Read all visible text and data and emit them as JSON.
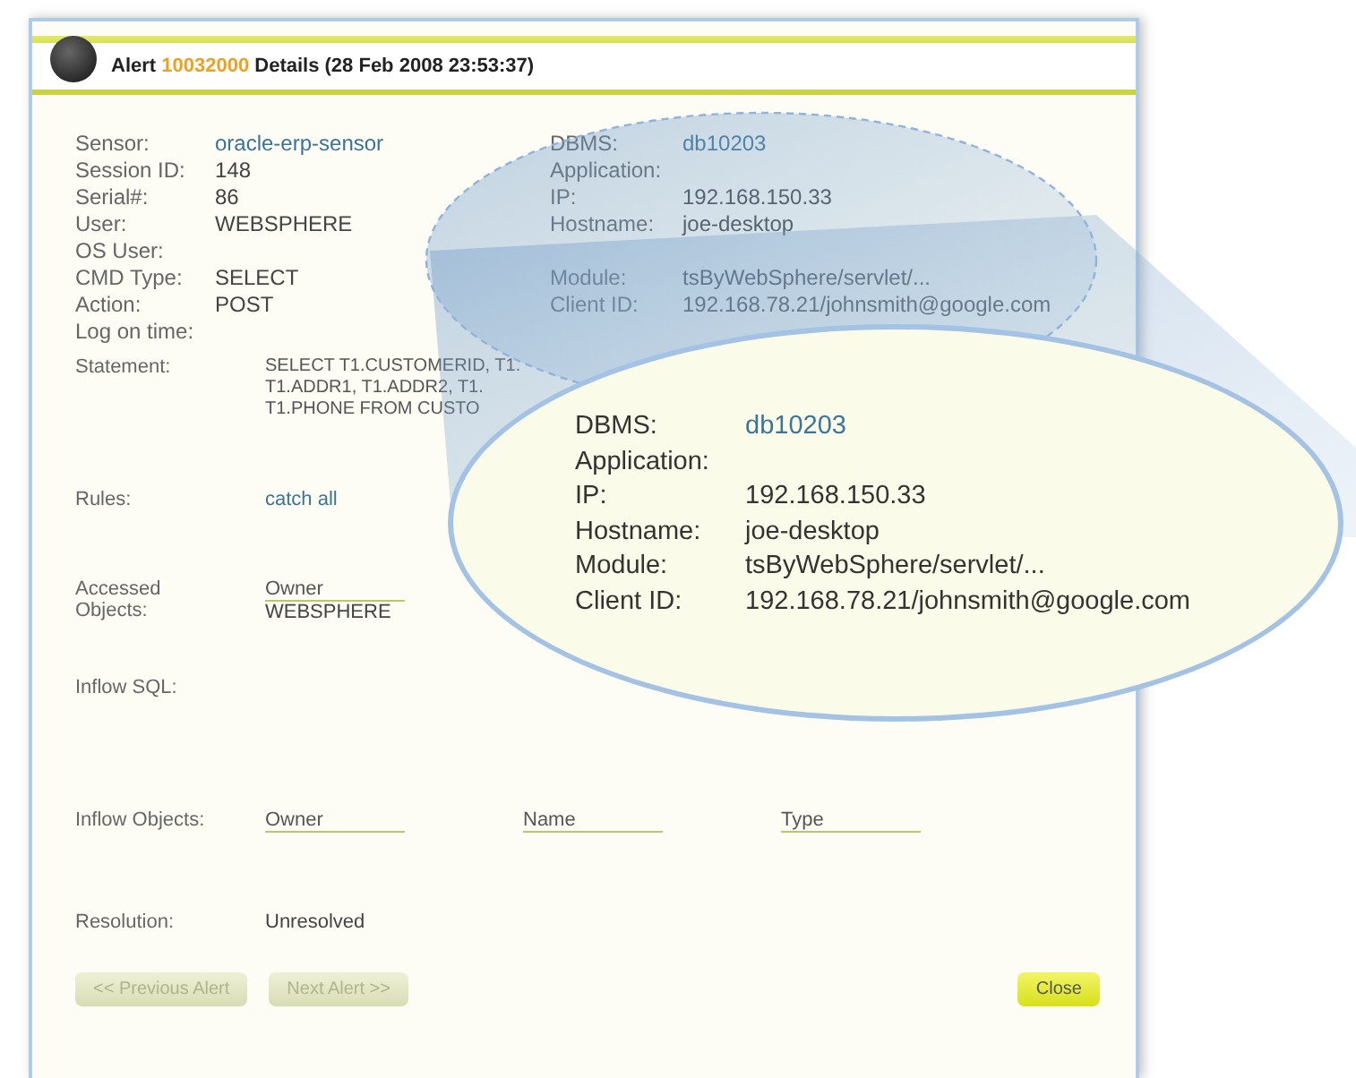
{
  "header": {
    "title_prefix": "Alert",
    "alert_id": "10032000",
    "title_suffix": "Details (28 Feb 2008 23:53:37)"
  },
  "session_fields": [
    {
      "label": "Sensor:",
      "value": "oracle-erp-sensor",
      "kind": "link"
    },
    {
      "label": "Session ID:",
      "value": "148",
      "kind": "text"
    },
    {
      "label": "Serial#:",
      "value": "86",
      "kind": "text"
    },
    {
      "label": "User:",
      "value": "WEBSPHERE",
      "kind": "text"
    },
    {
      "label": "OS User:"
    },
    {
      "label": "CMD Type:",
      "value": "SELECT",
      "kind": "text"
    },
    {
      "label": "Action:",
      "value": "POST",
      "kind": "text"
    },
    {
      "label": "Log on time:"
    }
  ],
  "connection_groups": [
    [
      {
        "label": "DBMS:",
        "value": "db10203",
        "kind": "link"
      },
      {
        "label": "Application:"
      },
      {
        "label": "IP:",
        "value": "192.168.150.33",
        "kind": "text"
      },
      {
        "label": "Hostname:",
        "value": "joe-desktop",
        "kind": "text"
      }
    ],
    [
      {
        "label": "Module:",
        "value": "tsByWebSphere/servlet/...",
        "kind": "text"
      },
      {
        "label": "Client ID:",
        "value": "192.168.78.21/johnsmith@google.com",
        "kind": "text"
      }
    ]
  ],
  "statement": {
    "label": "Statement:",
    "lines": [
      "SELECT T1.CUSTOMERID, T1.",
      "T1.ADDR1, T1.ADDR2, T1.",
      "T1.PHONE FROM CUSTO"
    ]
  },
  "rules": {
    "label": "Rules:",
    "value": "catch all"
  },
  "accessed_objects": {
    "label": "Accessed Objects:",
    "columns": [
      {
        "header": "Owner",
        "value": "WEBSPHERE"
      }
    ]
  },
  "inflow_sql": {
    "label": "Inflow SQL:"
  },
  "inflow_objects": {
    "label": "Inflow Objects:",
    "columns": [
      "Owner",
      "Name",
      "Type"
    ]
  },
  "resolution": {
    "label": "Resolution:",
    "value": "Unresolved"
  },
  "buttons": [
    {
      "label": "<< Previous Alert",
      "disabled": true
    },
    {
      "label": "Next Alert >>",
      "disabled": true
    },
    {
      "label": "Close",
      "disabled": false
    }
  ],
  "callout": {
    "fields": [
      {
        "label": "DBMS:",
        "value": "db10203",
        "kind": "link"
      },
      {
        "label": "Application:"
      },
      {
        "label": "IP:",
        "value": "192.168.150.33",
        "kind": "text"
      },
      {
        "label": "Hostname:",
        "value": "joe-desktop",
        "kind": "text"
      },
      {
        "label": "Module:",
        "value": "tsByWebSphere/servlet/...",
        "kind": "text"
      },
      {
        "label": "Client ID:",
        "value": "192.168.78.21/johnsmith@google.com",
        "kind": "text"
      }
    ]
  }
}
